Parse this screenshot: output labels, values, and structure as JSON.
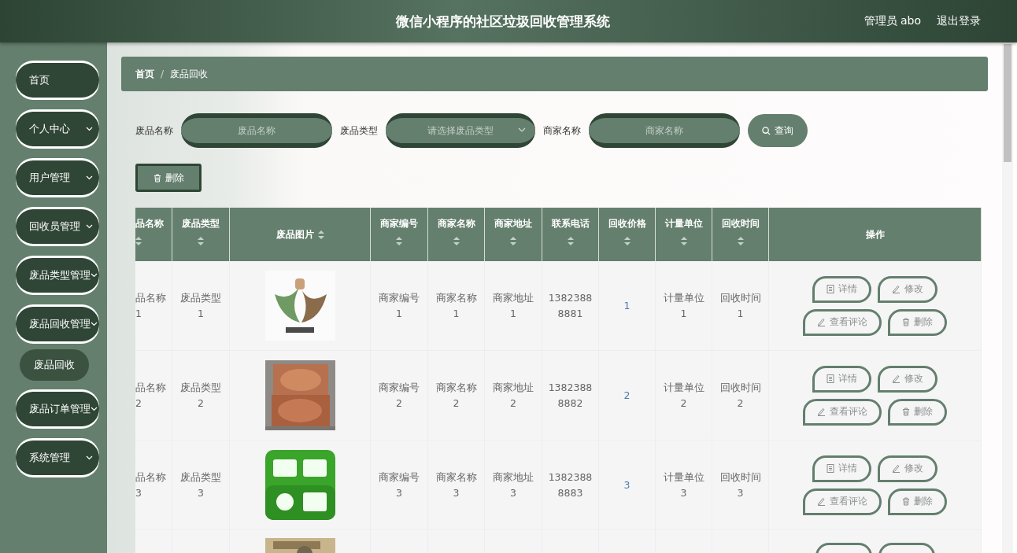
{
  "header": {
    "title": "微信小程序的社区垃圾回收管理系统",
    "user": "管理员 abo",
    "logout": "退出登录"
  },
  "sidebar": {
    "items": [
      {
        "label": "首页",
        "expandable": false
      },
      {
        "label": "个人中心",
        "expandable": true
      },
      {
        "label": "用户管理",
        "expandable": true
      },
      {
        "label": "回收员管理",
        "expandable": true
      },
      {
        "label": "废品类型管理",
        "expandable": true
      },
      {
        "label": "废品回收管理",
        "expandable": true,
        "children": [
          {
            "label": "废品回收",
            "selected": true
          }
        ]
      },
      {
        "label": "废品订单管理",
        "expandable": true
      },
      {
        "label": "系统管理",
        "expandable": true
      }
    ]
  },
  "breadcrumb": {
    "separator": "/",
    "items": [
      "首页",
      "废品回收"
    ]
  },
  "filters": [
    {
      "kind": "input",
      "label": "废品名称",
      "placeholder": "废品名称"
    },
    {
      "kind": "select",
      "label": "废品类型",
      "placeholder": "请选择废品类型"
    },
    {
      "kind": "input",
      "label": "商家名称",
      "placeholder": "商家名称"
    }
  ],
  "search_button": "查询",
  "delete_button": "删除",
  "table": {
    "columns": [
      {
        "label": "品名称",
        "sortable": true
      },
      {
        "label": "废品类型",
        "sortable": true
      },
      {
        "label": "废品图片",
        "sortable": true
      },
      {
        "label": "商家编号",
        "sortable": true
      },
      {
        "label": "商家名称",
        "sortable": true
      },
      {
        "label": "商家地址",
        "sortable": true
      },
      {
        "label": "联系电话",
        "sortable": true
      },
      {
        "label": "回收价格",
        "sortable": true
      },
      {
        "label": "计量单位",
        "sortable": true
      },
      {
        "label": "回收时间",
        "sortable": true
      },
      {
        "label": "操作",
        "sortable": false
      }
    ],
    "rows": [
      {
        "kind": "full",
        "cells": [
          "品名称1",
          "废品类型1",
          "商家编号1",
          "商家名称1",
          "商家地址1",
          "13823888881",
          "1",
          "计量单位1",
          "回收时间1"
        ],
        "actions": [
          {
            "kind": "document",
            "label": "详情"
          },
          {
            "kind": "pen",
            "label": "修改"
          },
          {
            "kind": "pen",
            "label": "查看评论"
          },
          {
            "kind": "trash",
            "label": "删除"
          }
        ]
      },
      {
        "kind": "full",
        "cells": [
          "品名称2",
          "废品类型2",
          "商家编号2",
          "商家名称2",
          "商家地址2",
          "13823888882",
          "2",
          "计量单位2",
          "回收时间2"
        ],
        "actions": [
          {
            "kind": "document",
            "label": "详情"
          },
          {
            "kind": "pen",
            "label": "修改"
          },
          {
            "kind": "pen",
            "label": "查看评论"
          },
          {
            "kind": "trash",
            "label": "删除"
          }
        ]
      },
      {
        "kind": "full",
        "cells": [
          "品名称3",
          "废品类型3",
          "商家编号3",
          "商家名称3",
          "商家地址3",
          "13823888883",
          "3",
          "计量单位3",
          "回收时间3"
        ],
        "actions": [
          {
            "kind": "document",
            "label": "详情"
          },
          {
            "kind": "pen",
            "label": "修改"
          },
          {
            "kind": "pen",
            "label": "查看评论"
          },
          {
            "kind": "trash",
            "label": "删除"
          }
        ]
      },
      {
        "kind": "partial"
      }
    ]
  }
}
